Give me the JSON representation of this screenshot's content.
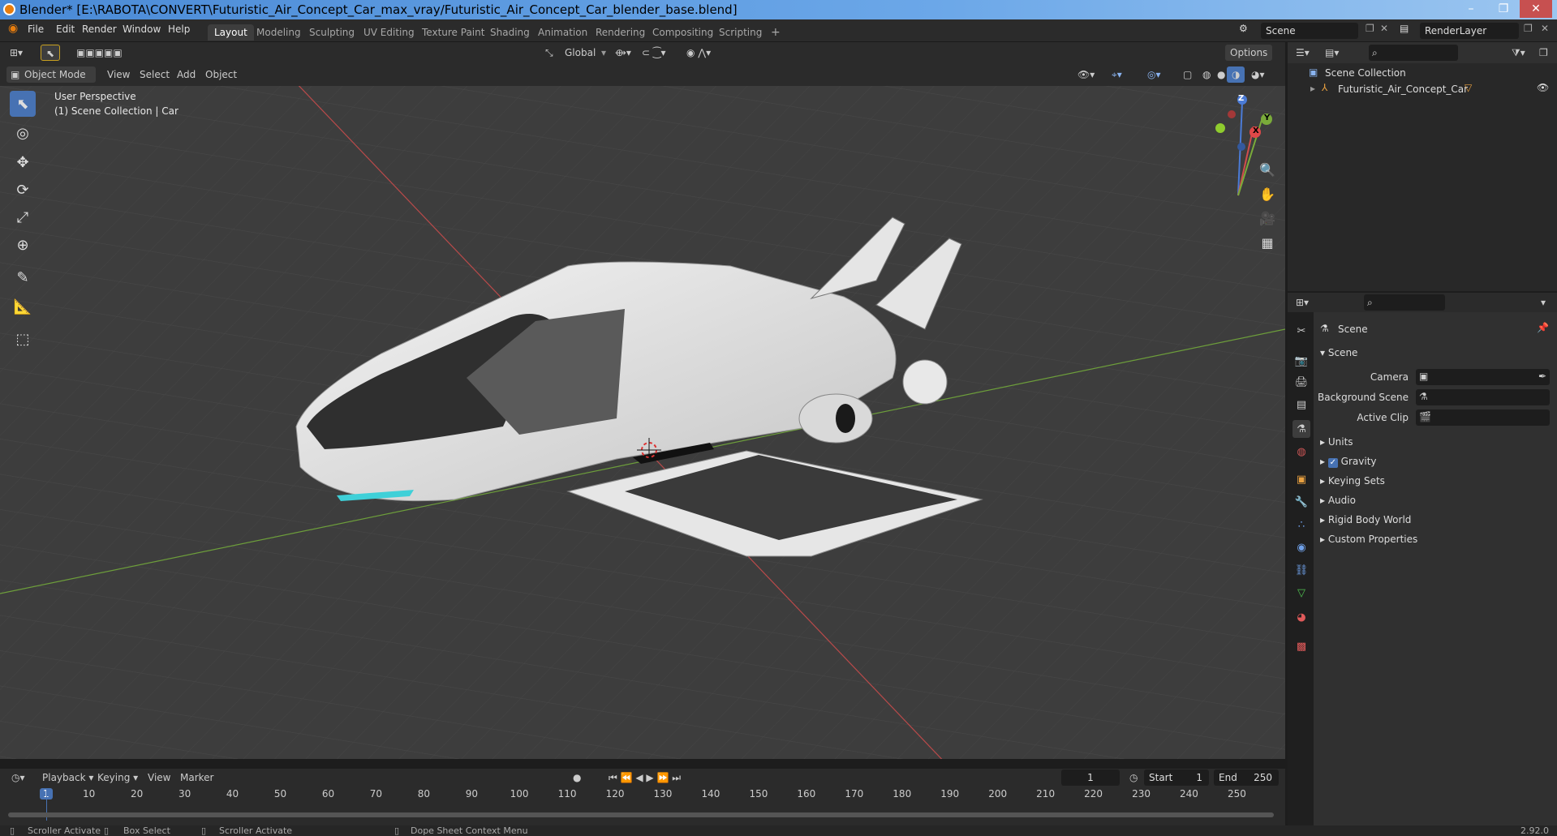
{
  "window": {
    "title": "Blender* [E:\\RABOTA\\CONVERT\\Futuristic_Air_Concept_Car_max_vray/Futuristic_Air_Concept_Car_blender_base.blend]",
    "min": "–",
    "max": "❐",
    "close": "✕"
  },
  "menu": {
    "file": "File",
    "edit": "Edit",
    "render": "Render",
    "window": "Window",
    "help": "Help"
  },
  "workspaces": [
    "Layout",
    "Modeling",
    "Sculpting",
    "UV Editing",
    "Texture Paint",
    "Shading",
    "Animation",
    "Rendering",
    "Compositing",
    "Scripting"
  ],
  "add_workspace": "+",
  "scene_field": "Scene",
  "view_layer_field": "RenderLayer",
  "viewport_header": {
    "mode": "Object Mode",
    "view": "View",
    "select": "Select",
    "add": "Add",
    "object": "Object",
    "transform": "Global",
    "options": "Options"
  },
  "viewport": {
    "perspective": "User Perspective",
    "collection": "(1) Scene Collection | Car",
    "axis_x": "X",
    "axis_y": "Y",
    "axis_z": "Z"
  },
  "outliner": {
    "root": "Scene Collection",
    "item": "Futuristic_Air_Concept_Car"
  },
  "properties": {
    "header": "Scene",
    "section": "Scene",
    "camera_label": "Camera",
    "background_label": "Background Scene",
    "clip_label": "Active Clip",
    "sections": [
      "Units",
      "Gravity",
      "Keying Sets",
      "Audio",
      "Rigid Body World",
      "Custom Properties"
    ]
  },
  "timeline": {
    "playback": "Playback",
    "keying": "Keying",
    "view": "View",
    "marker": "Marker",
    "current_frame": "1",
    "start_label": "Start",
    "start": "1",
    "end_label": "End",
    "end": "250",
    "ticks": [
      "1",
      "10",
      "20",
      "30",
      "40",
      "50",
      "60",
      "70",
      "80",
      "90",
      "100",
      "110",
      "120",
      "130",
      "140",
      "150",
      "160",
      "170",
      "180",
      "190",
      "200",
      "210",
      "220",
      "230",
      "240",
      "250"
    ]
  },
  "status": {
    "a": "Scroller Activate",
    "b": "Box Select",
    "c": "Scroller Activate",
    "d": "Dope Sheet Context Menu",
    "version": "2.92.0"
  }
}
